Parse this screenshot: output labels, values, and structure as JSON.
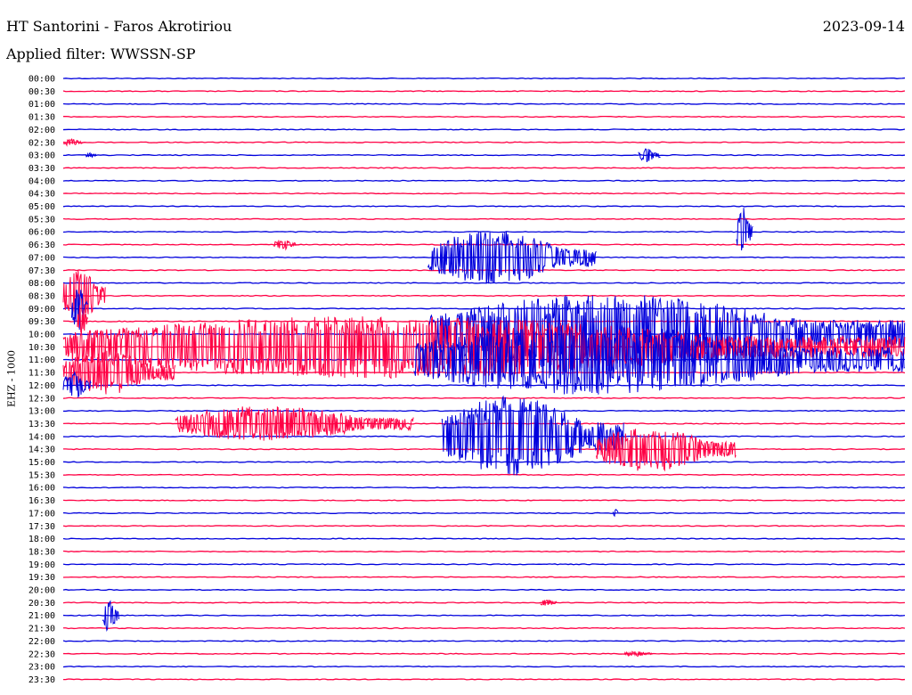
{
  "header": {
    "station": "HT Santorini - Faros Akrotiriou",
    "date": "2023-09-14",
    "filter": "Applied filter: WWSSN-SP",
    "channel": "EHZ - 1000"
  },
  "colors": {
    "even_hour": "#0000dd",
    "half_hour": "#ff0044"
  },
  "chart_data": {
    "type": "helicorder",
    "title": "HT Santorini - Faros Akrotiriou",
    "date": "2023-09-14",
    "ylabel": "EHZ - 1000",
    "row_labels": [
      "00:00",
      "00:30",
      "01:00",
      "01:30",
      "02:00",
      "02:30",
      "03:00",
      "03:30",
      "04:00",
      "04:30",
      "05:00",
      "05:30",
      "06:00",
      "06:30",
      "07:00",
      "07:30",
      "08:00",
      "08:30",
      "09:00",
      "09:30",
      "10:00",
      "10:30",
      "11:00",
      "11:30",
      "12:00",
      "12:30",
      "13:00",
      "13:30",
      "14:00",
      "14:30",
      "15:00",
      "15:30",
      "16:00",
      "16:30",
      "17:00",
      "17:30",
      "18:00",
      "18:30",
      "19:00",
      "19:30",
      "20:00",
      "20:30",
      "21:00",
      "21:30",
      "22:00",
      "22:30",
      "23:00",
      "23:30"
    ],
    "row_minutes": 30,
    "series_colors": [
      "#0000dd",
      "#ff0044"
    ],
    "events": [
      {
        "row": "02:30",
        "start_min": 0.0,
        "end_min": 0.7,
        "amp": 4
      },
      {
        "row": "03:00",
        "start_min": 20.5,
        "end_min": 21.3,
        "amp": 8
      },
      {
        "row": "03:00",
        "start_min": 0.8,
        "end_min": 1.2,
        "amp": 3
      },
      {
        "row": "06:00",
        "start_min": 24.0,
        "end_min": 24.6,
        "amp": 28
      },
      {
        "row": "06:30",
        "start_min": 7.5,
        "end_min": 8.3,
        "amp": 6
      },
      {
        "row": "07:00",
        "start_min": 13.0,
        "end_min": 19.0,
        "amp": 30
      },
      {
        "row": "08:30",
        "start_min": 0.0,
        "end_min": 1.5,
        "amp": 30
      },
      {
        "row": "09:00",
        "start_min": 0.3,
        "end_min": 0.9,
        "amp": 25
      },
      {
        "row": "09:30",
        "start_min": 0.5,
        "end_min": 0.9,
        "amp": 20
      },
      {
        "row": "10:00",
        "start_min": 13.0,
        "end_min": 30.0,
        "amp": 45
      },
      {
        "row": "10:30",
        "start_min": 0.0,
        "end_min": 30.0,
        "amp": 35
      },
      {
        "row": "11:00",
        "start_min": 12.5,
        "end_min": 30.0,
        "amp": 40
      },
      {
        "row": "11:30",
        "start_min": 0.0,
        "end_min": 4.0,
        "amp": 25
      },
      {
        "row": "12:00",
        "start_min": 0.0,
        "end_min": 1.0,
        "amp": 15
      },
      {
        "row": "13:30",
        "start_min": 4.0,
        "end_min": 12.5,
        "amp": 20
      },
      {
        "row": "14:00",
        "start_min": 13.5,
        "end_min": 20.0,
        "amp": 45
      },
      {
        "row": "14:30",
        "start_min": 19.0,
        "end_min": 24.0,
        "amp": 25
      },
      {
        "row": "17:00",
        "start_min": 19.6,
        "end_min": 19.8,
        "amp": 6
      },
      {
        "row": "20:30",
        "start_min": 17.0,
        "end_min": 17.6,
        "amp": 4
      },
      {
        "row": "21:00",
        "start_min": 1.4,
        "end_min": 2.0,
        "amp": 18
      },
      {
        "row": "22:30",
        "start_min": 20.0,
        "end_min": 21.0,
        "amp": 3
      }
    ]
  }
}
